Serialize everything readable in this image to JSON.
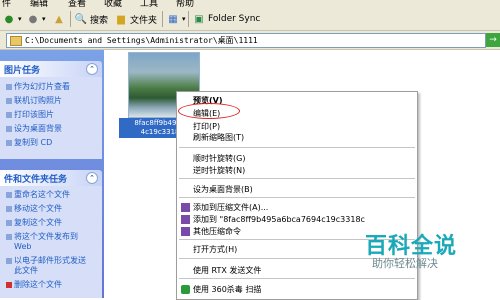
{
  "menubar": {
    "items": [
      "件",
      "编辑",
      "查看",
      "收藏",
      "工具",
      "帮助"
    ]
  },
  "toolbar": {
    "back": "◀",
    "search_label": "搜索",
    "folders_label": "文件夹",
    "folder_sync_label": "Folder Sync"
  },
  "address": {
    "path": "C:\\Documents and Settings\\Administrator\\桌面\\1111",
    "go_label": "→"
  },
  "sidebar": {
    "picture_tasks": {
      "title": "图片任务",
      "items": [
        "作为幻灯片查看",
        "联机订购照片",
        "打印该图片",
        "设为桌面背景",
        "复制到 CD"
      ]
    },
    "file_tasks": {
      "title": "件和文件夹任务",
      "items": [
        "重命名这个文件",
        "移动这个文件",
        "复制这个文件",
        "将这个文件发布到",
        "Web",
        "以电子邮件形式发送",
        "此文件",
        "删除这个文件"
      ]
    }
  },
  "file": {
    "name_line1": "8fac8ff9b495a6",
    "name_line2": "4c19c3318c"
  },
  "context_menu": {
    "items": [
      "预览(V)",
      "编辑(E)",
      "打印(P)",
      "刷新缩略图(T)",
      "顺时针旋转(G)",
      "逆时针旋转(N)",
      "设为桌面背景(B)",
      "添加到压缩文件(A)...",
      "添加到 \"8fac8ff9b495a6bca7694c19c3318c",
      "其他压缩命令",
      "打开方式(H)",
      "使用 RTX 发送文件",
      "使用 360杀毒 扫描"
    ]
  },
  "watermark": {
    "title": "百科全说",
    "subtitle": "助你轻松解决"
  }
}
